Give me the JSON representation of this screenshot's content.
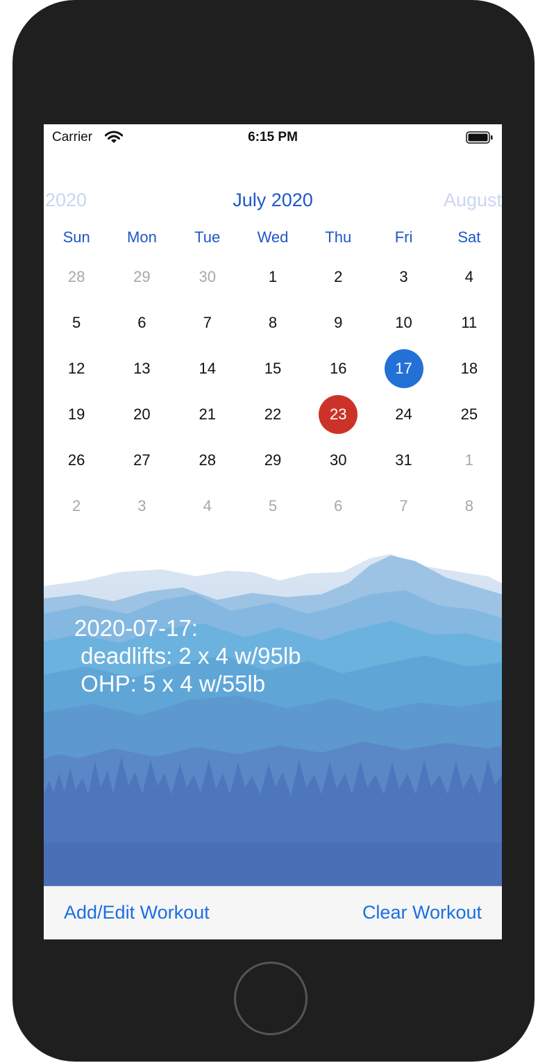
{
  "status_bar": {
    "carrier": "Carrier",
    "time": "6:15 PM",
    "icons": [
      "wifi-icon",
      "battery-icon"
    ]
  },
  "calendar": {
    "prev_month": "2020",
    "current_month": "July 2020",
    "next_month": "August",
    "weekdays": [
      "Sun",
      "Mon",
      "Tue",
      "Wed",
      "Thu",
      "Fri",
      "Sat"
    ],
    "days": [
      {
        "label": "28",
        "muted": true
      },
      {
        "label": "29",
        "muted": true
      },
      {
        "label": "30",
        "muted": true
      },
      {
        "label": "1"
      },
      {
        "label": "2"
      },
      {
        "label": "3"
      },
      {
        "label": "4"
      },
      {
        "label": "5"
      },
      {
        "label": "6"
      },
      {
        "label": "7"
      },
      {
        "label": "8"
      },
      {
        "label": "9"
      },
      {
        "label": "10"
      },
      {
        "label": "11"
      },
      {
        "label": "12"
      },
      {
        "label": "13"
      },
      {
        "label": "14"
      },
      {
        "label": "15"
      },
      {
        "label": "16"
      },
      {
        "label": "17",
        "state": "selected"
      },
      {
        "label": "18"
      },
      {
        "label": "19"
      },
      {
        "label": "20"
      },
      {
        "label": "21"
      },
      {
        "label": "22"
      },
      {
        "label": "23",
        "state": "today"
      },
      {
        "label": "24"
      },
      {
        "label": "25"
      },
      {
        "label": "26"
      },
      {
        "label": "27"
      },
      {
        "label": "28"
      },
      {
        "label": "29"
      },
      {
        "label": "30"
      },
      {
        "label": "31"
      },
      {
        "label": "1",
        "muted": true
      },
      {
        "label": "2",
        "muted": true
      },
      {
        "label": "3",
        "muted": true
      },
      {
        "label": "4",
        "muted": true
      },
      {
        "label": "5",
        "muted": true
      },
      {
        "label": "6",
        "muted": true
      },
      {
        "label": "7",
        "muted": true
      },
      {
        "label": "8",
        "muted": true
      }
    ]
  },
  "workout_text": {
    "date": "2020-07-17:",
    "lines": [
      " deadlifts: 2 x 4 w/95lb",
      " OHP: 5 x 4 w/55lb"
    ]
  },
  "toolbar": {
    "add_edit_label": "Add/Edit Workout",
    "clear_label": "Clear Workout"
  },
  "colors": {
    "accent": "#1e56c8",
    "selected": "#2371d6",
    "today": "#cc3328",
    "toolbar_text": "#1b6fe0"
  }
}
